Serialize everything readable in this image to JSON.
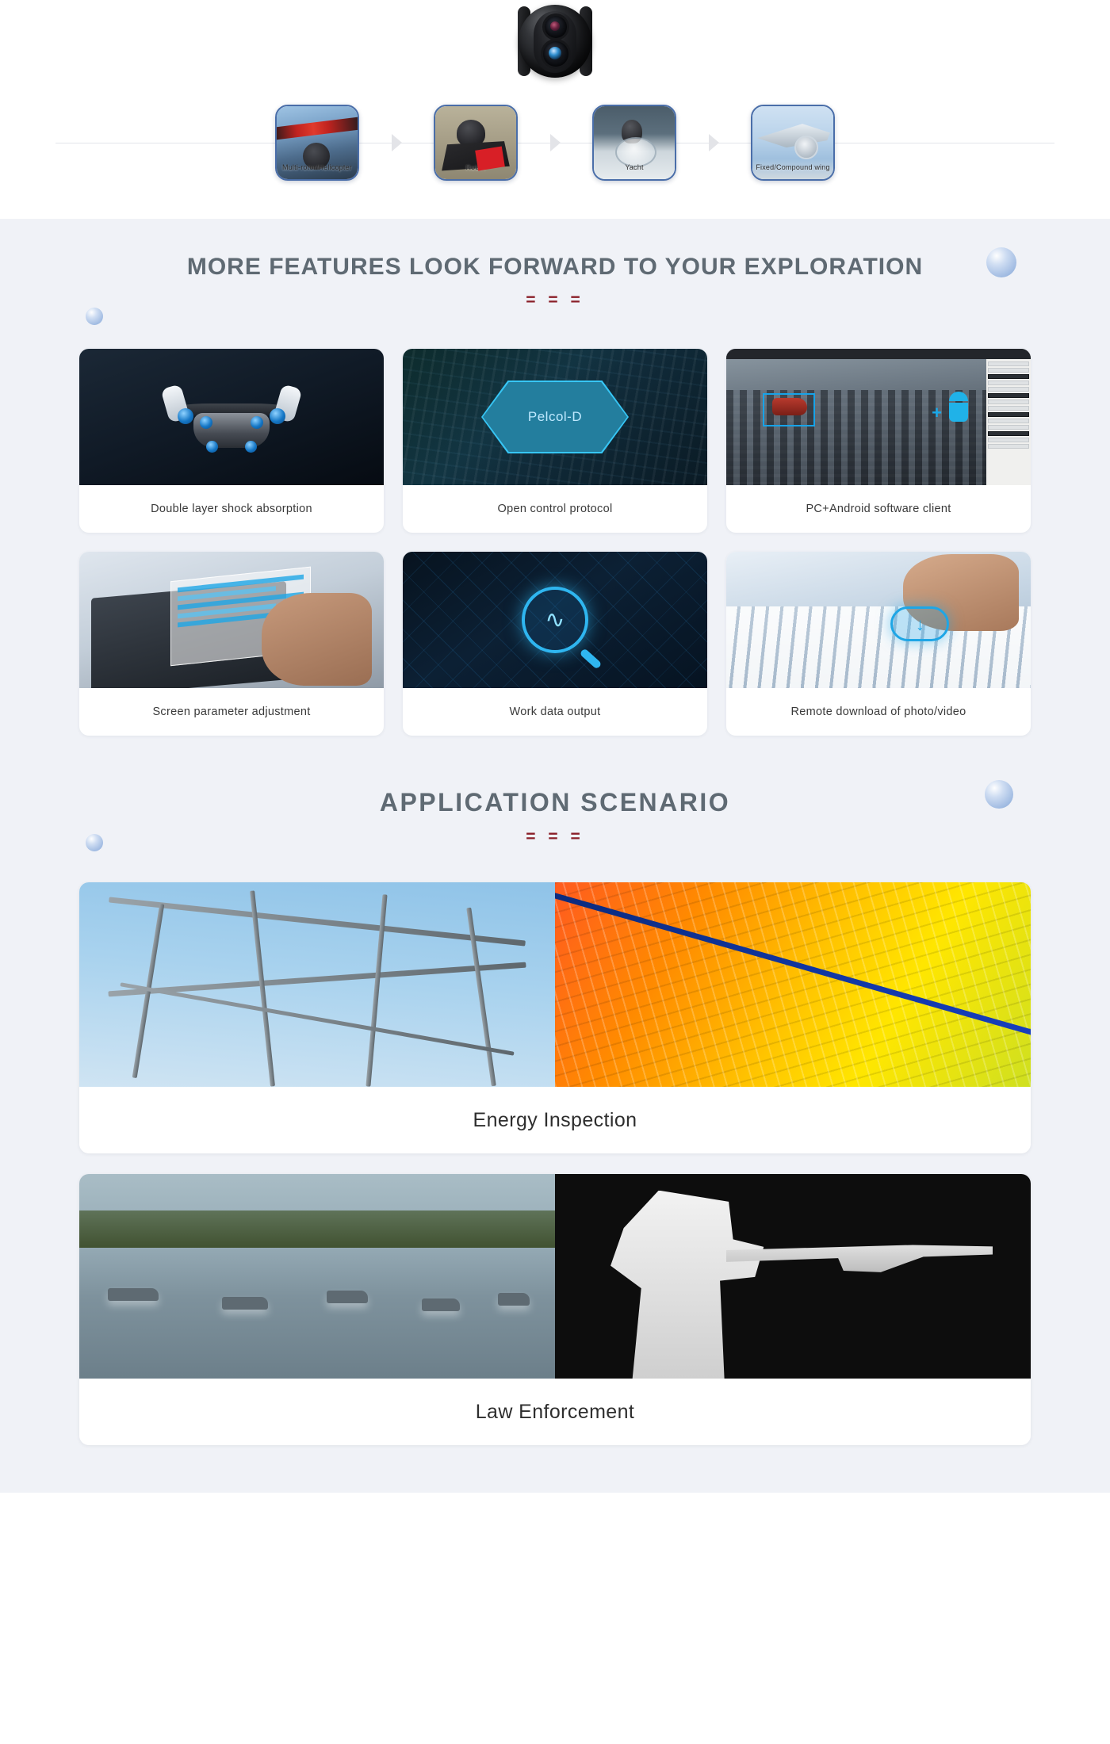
{
  "hero": {
    "gimbal_alt": "dual-sensor gimbal camera",
    "platforms": [
      {
        "label": "Multi-rotor/Helicopter",
        "art": "art-drone"
      },
      {
        "label": "Robot",
        "art": "art-robot"
      },
      {
        "label": "Yacht",
        "art": "art-yacht"
      },
      {
        "label": "Fixed/Compound wing",
        "art": "art-wing"
      }
    ],
    "arrow_glyph": "▶"
  },
  "features_section": {
    "title": "MORE FEATURES LOOK FORWARD TO YOUR EXPLORATION",
    "divider": "= = =",
    "cards": [
      {
        "caption": "Double layer shock absorption",
        "thumb": "th-shock",
        "overlay_text": ""
      },
      {
        "caption": "Open control protocol",
        "thumb": "th-proto",
        "overlay_text": "Pelcol-D"
      },
      {
        "caption": "PC+Android software client",
        "thumb": "th-client",
        "overlay_text": ""
      },
      {
        "caption": "Screen parameter adjustment",
        "thumb": "th-screen",
        "overlay_text": ""
      },
      {
        "caption": "Work data output",
        "thumb": "th-work",
        "overlay_text": ""
      },
      {
        "caption": "Remote download of photo/video",
        "thumb": "th-remote",
        "overlay_text": ""
      }
    ]
  },
  "scenario_section": {
    "title": "APPLICATION SCENARIO",
    "divider": "= = =",
    "cards": [
      {
        "caption": "Energy Inspection",
        "left_art": "sc-tower",
        "right_art": "sc-solar"
      },
      {
        "caption": "Law Enforcement",
        "left_art": "sc-river",
        "right_art": "sc-thermal"
      }
    ]
  },
  "colors": {
    "page_bg": "#ffffff",
    "section_bg": "#f0f2f7",
    "heading": "#5f6a73",
    "divider_red": "#8a1f28",
    "card_border_blue": "#4a6ea9",
    "accent_cyan": "#37c6f5",
    "orb_blue": "#7ea2d6"
  }
}
